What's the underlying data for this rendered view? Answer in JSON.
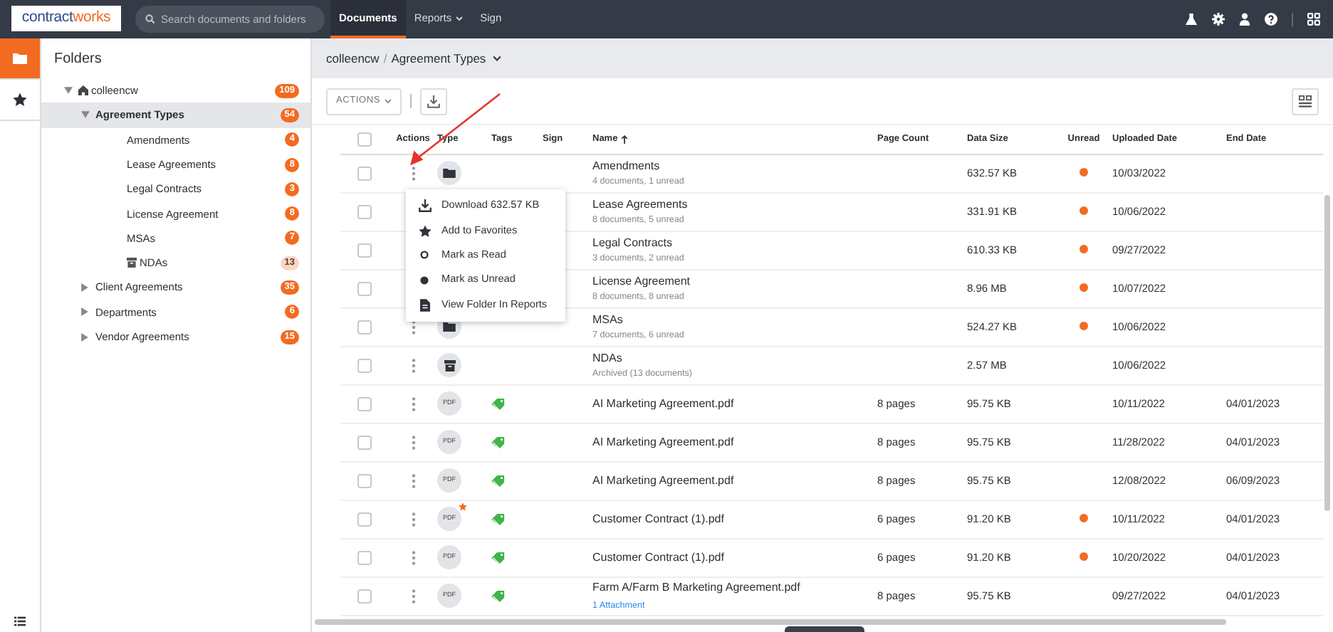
{
  "logo": {
    "first": "contract",
    "second": "works"
  },
  "search": {
    "placeholder": "Search documents and folders"
  },
  "nav_tabs": [
    {
      "label": "Documents",
      "selected": true,
      "dropdown": false
    },
    {
      "label": "Reports",
      "selected": false,
      "dropdown": true
    },
    {
      "label": "Sign",
      "selected": false,
      "dropdown": false
    }
  ],
  "rail": [
    {
      "kind": "folder",
      "selected": true
    },
    {
      "kind": "star",
      "selected": false
    }
  ],
  "folders": {
    "title": "Folders",
    "tree": [
      {
        "label": "colleencw",
        "count": "109",
        "kind": "home",
        "expanded": true,
        "selected": false,
        "children": [
          {
            "label": "Agreement Types",
            "count": "54",
            "expanded": true,
            "selected": true,
            "children": [
              {
                "label": "Amendments",
                "count": "4",
                "selected": false
              },
              {
                "label": "Lease Agreements",
                "count": "8",
                "selected": false
              },
              {
                "label": "Legal Contracts",
                "count": "3",
                "selected": false
              },
              {
                "label": "License Agreement",
                "count": "8",
                "selected": false
              },
              {
                "label": "MSAs",
                "count": "7",
                "selected": false
              },
              {
                "label": "NDAs",
                "count": "13",
                "kind": "archived",
                "selected": false
              }
            ]
          },
          {
            "label": "Client Agreements",
            "count": "35",
            "expanded": false,
            "selected": false
          },
          {
            "label": "Departments",
            "count": "6",
            "expanded": false,
            "selected": false
          },
          {
            "label": "Vendor Agreements",
            "count": "15",
            "expanded": false,
            "selected": false
          }
        ]
      }
    ]
  },
  "breadcrumb": [
    "colleencw",
    "Agreement Types"
  ],
  "breadcrumb_separator": "/",
  "toolbar": {
    "actions": "ACTIONS"
  },
  "columns": [
    {
      "kind": "check",
      "checked": false
    },
    {
      "label": "Actions",
      "kind": "text"
    },
    {
      "label": "Type",
      "kind": "text"
    },
    {
      "label": "Tags",
      "kind": "text"
    },
    {
      "label": "Sign",
      "kind": "text"
    },
    {
      "label": "Name",
      "kind": "sorted"
    },
    {
      "label": "Page Count",
      "kind": "text"
    },
    {
      "label": "Data Size",
      "kind": "text"
    },
    {
      "label": "Unread",
      "kind": "text"
    },
    {
      "label": "Uploaded Date",
      "kind": "text"
    },
    {
      "label": "End Date",
      "kind": "text"
    }
  ],
  "rows": [
    {
      "checked": false,
      "kind": "folder",
      "name": "Amendments",
      "subtitle": "4 documents, 1 unread",
      "data_size": "632.57 KB",
      "unread": true,
      "uploaded": "10/03/2022"
    },
    {
      "checked": false,
      "kind": "folder",
      "name": "Lease Agreements",
      "subtitle": "8 documents, 5 unread",
      "data_size": "331.91 KB",
      "unread": true,
      "uploaded": "10/06/2022"
    },
    {
      "checked": false,
      "kind": "folder",
      "name": "Legal Contracts",
      "subtitle": "3 documents, 2 unread",
      "data_size": "610.33 KB",
      "unread": true,
      "uploaded": "09/27/2022"
    },
    {
      "checked": false,
      "kind": "folder",
      "name": "License Agreement",
      "subtitle": "8 documents, 8 unread",
      "data_size": "8.96 MB",
      "unread": true,
      "uploaded": "10/07/2022"
    },
    {
      "checked": false,
      "kind": "folder",
      "name": "MSAs",
      "subtitle": "7 documents, 6 unread",
      "data_size": "524.27 KB",
      "unread": true,
      "uploaded": "10/06/2022"
    },
    {
      "checked": false,
      "kind": "archived",
      "name": "NDAs",
      "subtitle": "Archived (13 documents)",
      "data_size": "2.57 MB",
      "unread": false,
      "uploaded": "10/06/2022"
    },
    {
      "checked": false,
      "kind": "pdf",
      "type_label": "PDF",
      "tagged": true,
      "favorite": false,
      "name": "AI Marketing Agreement.pdf",
      "page_count": "8 pages",
      "data_size": "95.75 KB",
      "unread": false,
      "uploaded": "10/11/2022",
      "end_date": "04/01/2023"
    },
    {
      "checked": false,
      "kind": "pdf",
      "type_label": "PDF",
      "tagged": true,
      "favorite": false,
      "name": "AI Marketing Agreement.pdf",
      "page_count": "8 pages",
      "data_size": "95.75 KB",
      "unread": false,
      "uploaded": "11/28/2022",
      "end_date": "04/01/2023"
    },
    {
      "checked": false,
      "kind": "pdf",
      "type_label": "PDF",
      "tagged": true,
      "favorite": false,
      "name": "AI Marketing Agreement.pdf",
      "page_count": "8 pages",
      "data_size": "95.75 KB",
      "unread": false,
      "uploaded": "12/08/2022",
      "end_date": "06/09/2023"
    },
    {
      "checked": false,
      "kind": "pdf",
      "type_label": "PDF",
      "tagged": true,
      "favorite": true,
      "name": "Customer Contract (1).pdf",
      "page_count": "6 pages",
      "data_size": "91.20 KB",
      "unread": true,
      "uploaded": "10/11/2022",
      "end_date": "04/01/2023"
    },
    {
      "checked": false,
      "kind": "pdf",
      "type_label": "PDF",
      "tagged": true,
      "favorite": false,
      "name": "Customer Contract (1).pdf",
      "page_count": "6 pages",
      "data_size": "91.20 KB",
      "unread": true,
      "uploaded": "10/20/2022",
      "end_date": "04/01/2023"
    },
    {
      "checked": false,
      "kind": "pdf",
      "type_label": "PDF",
      "tagged": true,
      "favorite": false,
      "name": "Farm A/Farm B Marketing Agreement.pdf",
      "link": "1 Attachment",
      "page_count": "8 pages",
      "data_size": "95.75 KB",
      "unread": false,
      "uploaded": "09/27/2022",
      "end_date": "04/01/2023"
    }
  ],
  "context_menu": {
    "items": [
      {
        "kind": "download",
        "label": "Download 632.57 KB"
      },
      {
        "kind": "star",
        "label": "Add to Favorites"
      },
      {
        "kind": "ring",
        "label": "Mark as Read"
      },
      {
        "kind": "dot",
        "label": "Mark as Unread"
      },
      {
        "kind": "document",
        "label": "View Folder In Reports"
      }
    ]
  }
}
